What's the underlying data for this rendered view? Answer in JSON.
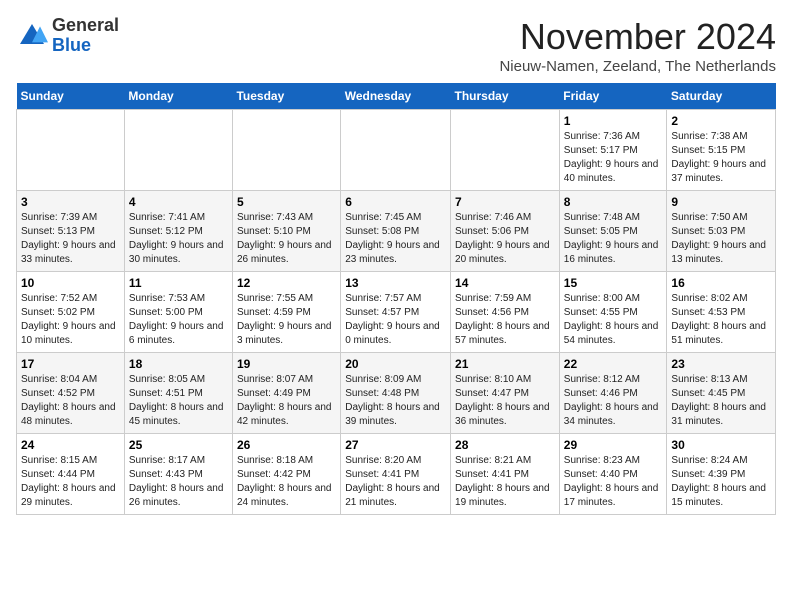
{
  "logo": {
    "general": "General",
    "blue": "Blue"
  },
  "header": {
    "month": "November 2024",
    "location": "Nieuw-Namen, Zeeland, The Netherlands"
  },
  "days_of_week": [
    "Sunday",
    "Monday",
    "Tuesday",
    "Wednesday",
    "Thursday",
    "Friday",
    "Saturday"
  ],
  "weeks": [
    [
      {
        "day": "",
        "info": ""
      },
      {
        "day": "",
        "info": ""
      },
      {
        "day": "",
        "info": ""
      },
      {
        "day": "",
        "info": ""
      },
      {
        "day": "",
        "info": ""
      },
      {
        "day": "1",
        "info": "Sunrise: 7:36 AM\nSunset: 5:17 PM\nDaylight: 9 hours and 40 minutes."
      },
      {
        "day": "2",
        "info": "Sunrise: 7:38 AM\nSunset: 5:15 PM\nDaylight: 9 hours and 37 minutes."
      }
    ],
    [
      {
        "day": "3",
        "info": "Sunrise: 7:39 AM\nSunset: 5:13 PM\nDaylight: 9 hours and 33 minutes."
      },
      {
        "day": "4",
        "info": "Sunrise: 7:41 AM\nSunset: 5:12 PM\nDaylight: 9 hours and 30 minutes."
      },
      {
        "day": "5",
        "info": "Sunrise: 7:43 AM\nSunset: 5:10 PM\nDaylight: 9 hours and 26 minutes."
      },
      {
        "day": "6",
        "info": "Sunrise: 7:45 AM\nSunset: 5:08 PM\nDaylight: 9 hours and 23 minutes."
      },
      {
        "day": "7",
        "info": "Sunrise: 7:46 AM\nSunset: 5:06 PM\nDaylight: 9 hours and 20 minutes."
      },
      {
        "day": "8",
        "info": "Sunrise: 7:48 AM\nSunset: 5:05 PM\nDaylight: 9 hours and 16 minutes."
      },
      {
        "day": "9",
        "info": "Sunrise: 7:50 AM\nSunset: 5:03 PM\nDaylight: 9 hours and 13 minutes."
      }
    ],
    [
      {
        "day": "10",
        "info": "Sunrise: 7:52 AM\nSunset: 5:02 PM\nDaylight: 9 hours and 10 minutes."
      },
      {
        "day": "11",
        "info": "Sunrise: 7:53 AM\nSunset: 5:00 PM\nDaylight: 9 hours and 6 minutes."
      },
      {
        "day": "12",
        "info": "Sunrise: 7:55 AM\nSunset: 4:59 PM\nDaylight: 9 hours and 3 minutes."
      },
      {
        "day": "13",
        "info": "Sunrise: 7:57 AM\nSunset: 4:57 PM\nDaylight: 9 hours and 0 minutes."
      },
      {
        "day": "14",
        "info": "Sunrise: 7:59 AM\nSunset: 4:56 PM\nDaylight: 8 hours and 57 minutes."
      },
      {
        "day": "15",
        "info": "Sunrise: 8:00 AM\nSunset: 4:55 PM\nDaylight: 8 hours and 54 minutes."
      },
      {
        "day": "16",
        "info": "Sunrise: 8:02 AM\nSunset: 4:53 PM\nDaylight: 8 hours and 51 minutes."
      }
    ],
    [
      {
        "day": "17",
        "info": "Sunrise: 8:04 AM\nSunset: 4:52 PM\nDaylight: 8 hours and 48 minutes."
      },
      {
        "day": "18",
        "info": "Sunrise: 8:05 AM\nSunset: 4:51 PM\nDaylight: 8 hours and 45 minutes."
      },
      {
        "day": "19",
        "info": "Sunrise: 8:07 AM\nSunset: 4:49 PM\nDaylight: 8 hours and 42 minutes."
      },
      {
        "day": "20",
        "info": "Sunrise: 8:09 AM\nSunset: 4:48 PM\nDaylight: 8 hours and 39 minutes."
      },
      {
        "day": "21",
        "info": "Sunrise: 8:10 AM\nSunset: 4:47 PM\nDaylight: 8 hours and 36 minutes."
      },
      {
        "day": "22",
        "info": "Sunrise: 8:12 AM\nSunset: 4:46 PM\nDaylight: 8 hours and 34 minutes."
      },
      {
        "day": "23",
        "info": "Sunrise: 8:13 AM\nSunset: 4:45 PM\nDaylight: 8 hours and 31 minutes."
      }
    ],
    [
      {
        "day": "24",
        "info": "Sunrise: 8:15 AM\nSunset: 4:44 PM\nDaylight: 8 hours and 29 minutes."
      },
      {
        "day": "25",
        "info": "Sunrise: 8:17 AM\nSunset: 4:43 PM\nDaylight: 8 hours and 26 minutes."
      },
      {
        "day": "26",
        "info": "Sunrise: 8:18 AM\nSunset: 4:42 PM\nDaylight: 8 hours and 24 minutes."
      },
      {
        "day": "27",
        "info": "Sunrise: 8:20 AM\nSunset: 4:41 PM\nDaylight: 8 hours and 21 minutes."
      },
      {
        "day": "28",
        "info": "Sunrise: 8:21 AM\nSunset: 4:41 PM\nDaylight: 8 hours and 19 minutes."
      },
      {
        "day": "29",
        "info": "Sunrise: 8:23 AM\nSunset: 4:40 PM\nDaylight: 8 hours and 17 minutes."
      },
      {
        "day": "30",
        "info": "Sunrise: 8:24 AM\nSunset: 4:39 PM\nDaylight: 8 hours and 15 minutes."
      }
    ]
  ]
}
